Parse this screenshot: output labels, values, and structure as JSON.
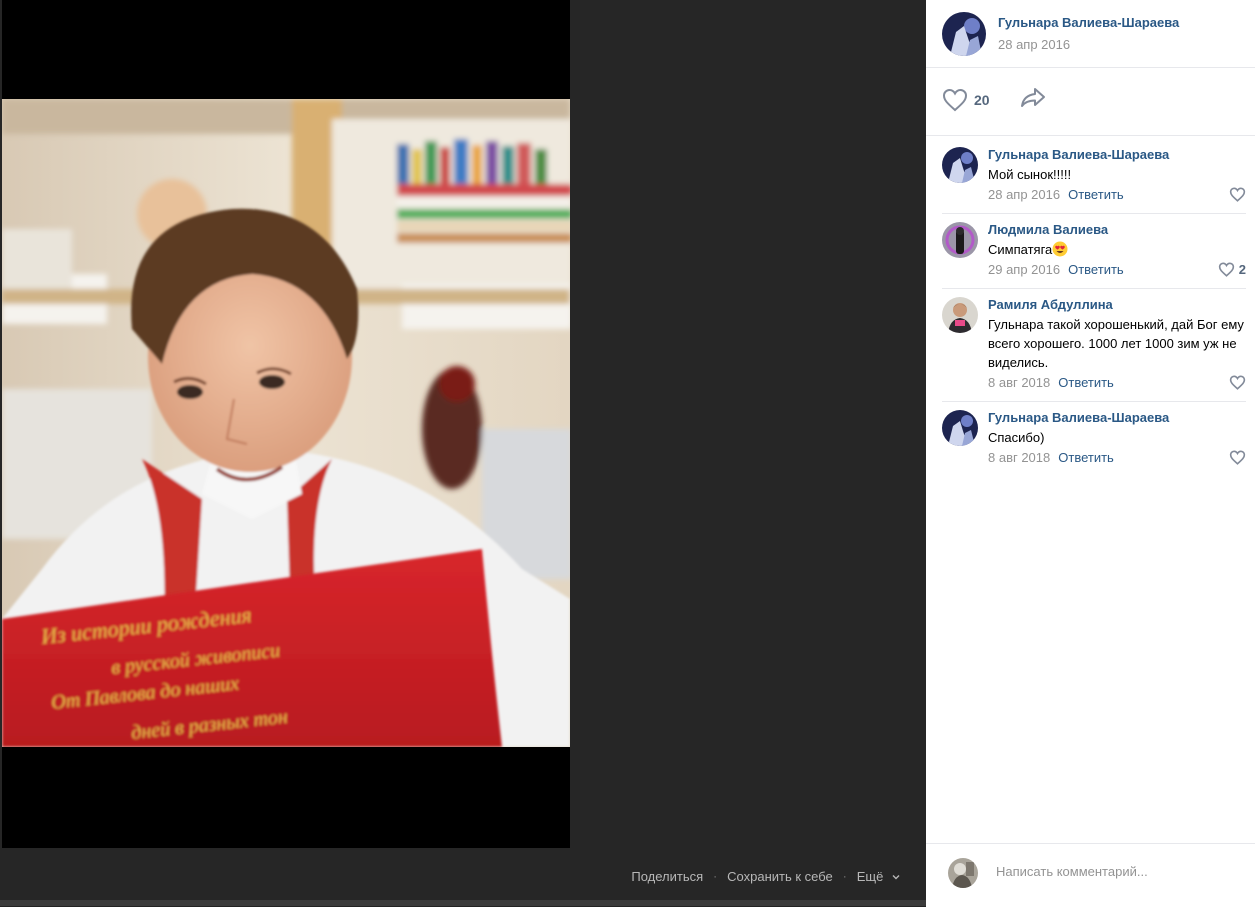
{
  "post": {
    "author_name": "Гульнара Валиева-Шараева",
    "date": "28 апр 2016",
    "like_count": "20"
  },
  "viewer": {
    "share_label": "Поделиться",
    "save_label": "Сохранить к себе",
    "more_label": "Ещё"
  },
  "comments": [
    {
      "name": "Гульнара Валиева-Шараева",
      "text": "Мой сынок!!!!!",
      "date": "28 апр 2016",
      "reply": "Ответить",
      "likes": ""
    },
    {
      "name": "Людмила Валиева",
      "text": "Симпатяга",
      "date": "29 апр 2016",
      "reply": "Ответить",
      "likes": "2"
    },
    {
      "name": "Рамиля Абдуллина",
      "text": "Гульнара такой хорошенький, дай Бог ему всего хорошего. 1000 лет 1000 зим уж не виделись.",
      "date": "8 авг 2018",
      "reply": "Ответить",
      "likes": ""
    },
    {
      "name": "Гульнара Валиева-Шараева",
      "text": "Спасибо)",
      "date": "8 авг 2018",
      "reply": "Ответить",
      "likes": ""
    }
  ],
  "composer": {
    "placeholder": "Написать комментарий..."
  },
  "colors": {
    "link": "#2a5885",
    "muted": "#939393",
    "viewer_bg": "#262626"
  }
}
